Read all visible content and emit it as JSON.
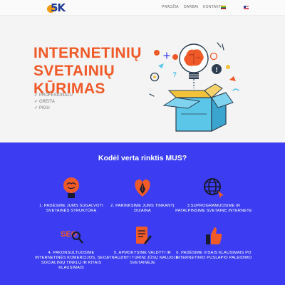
{
  "header": {
    "logo_mark": "5K",
    "nav": [
      "PRADŽIA",
      "DARBAI",
      "KONTAKTAI"
    ]
  },
  "hero": {
    "title_lines": [
      "INTERNETINIŲ",
      "SVETAINIŲ",
      "KŪRIMAS"
    ],
    "bullets": [
      "PROFESIONALU",
      "GREITA",
      "PIGU"
    ],
    "check_icon": "check-icon",
    "illustration": "open-box-ideas-illustration"
  },
  "features": {
    "title": "Kodėl verta rinktis MUS?",
    "items": [
      {
        "icon": "brain-lightbulb-icon",
        "text": "1. PADĖSIME JUMS SUGALVOTI SVETAINĖS STRUKTŪRĄ"
      },
      {
        "icon": "heart-pen-icon",
        "text": "2. PARINKSIME JUMS TINKANTĮ DIZAINĄ"
      },
      {
        "icon": "globe-icon",
        "text": "3.SUPROGRAMUOSIME IR PATALPINSIME SVETAINĘ INTERNETE"
      },
      {
        "icon": "seo-magnifier-icon",
        "text": "4. PAKONSULTUOSIME INTERNETINĖS KOMERCIJOS, SEO, SOCIALINIŲ TINKLŲ IR KITAIS KLAUSIMAIS"
      },
      {
        "icon": "document-edit-icon",
        "text": "5. APMOKYSIME VALDYTI IR ATNAUJINTI TURINĮ JŪSŲ NAUJOJE SVETAINĖJE"
      },
      {
        "icon": "thumbs-up-icon",
        "text": "6. PADĖSIME VISAIS KLAUSIMAIS PO INTERNETINIO PUSLAPIO PALEIDIMO"
      }
    ]
  },
  "colors": {
    "accent": "#ef5a28",
    "feature_bg": "#3c3df2",
    "logo_blue": "#1f3b96",
    "logo_orange": "#f39c12"
  }
}
